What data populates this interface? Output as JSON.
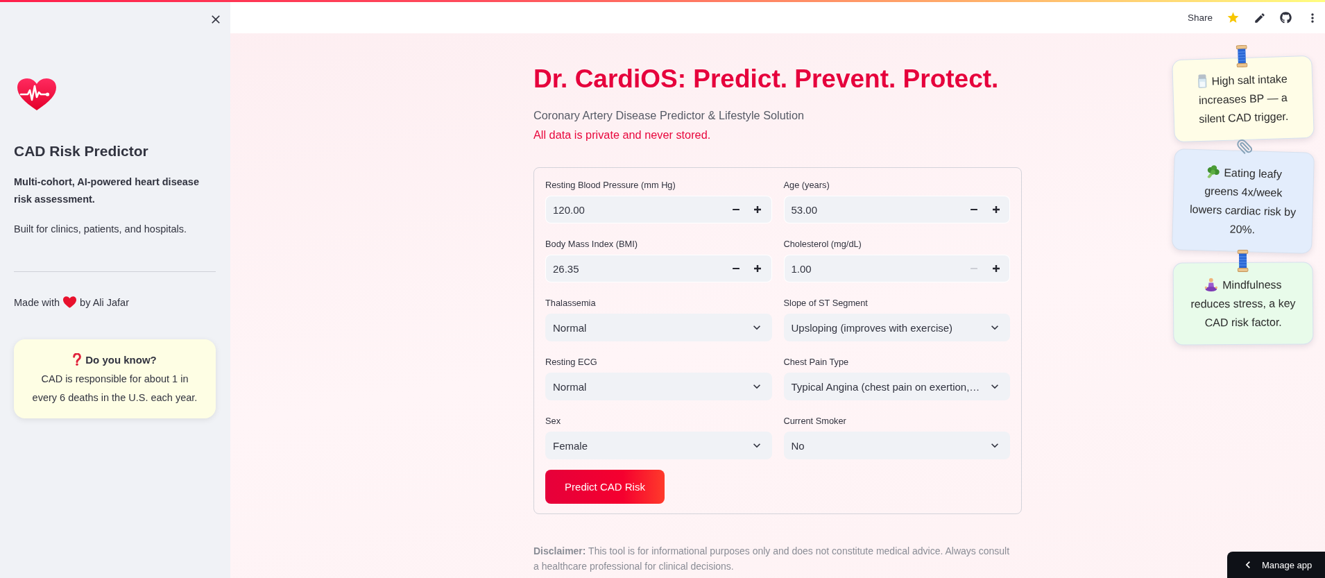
{
  "toolbar": {
    "share": "Share"
  },
  "sidebar": {
    "title": "CAD Risk Predictor",
    "tagline": "Multi-cohort, AI-powered heart disease risk assessment.",
    "description": "Built for clinics, patients, and hospitals.",
    "credit": {
      "before": "Made with",
      "after": "by Ali Jafar"
    },
    "fact_card": {
      "heading": "Do you know?",
      "text": "CAD is responsible for about 1 in every 6 deaths in the U.S. each year."
    }
  },
  "page": {
    "title": "Dr. CardiOS: Predict. Prevent. Protect.",
    "subtitle": "Coronary Artery Disease Predictor & Lifestyle Solution",
    "privacy_note": "All data is private and never stored."
  },
  "form": {
    "fields": [
      {
        "kind": "number",
        "label": "Resting Blood Pressure (mm Hg)",
        "value": "120.00",
        "decrement_disabled": false
      },
      {
        "kind": "number",
        "label": "Age (years)",
        "value": "53.00",
        "decrement_disabled": false
      },
      {
        "kind": "number",
        "label": "Body Mass Index (BMI)",
        "value": "26.35",
        "decrement_disabled": false
      },
      {
        "kind": "number",
        "label": "Cholesterol (mg/dL)",
        "value": "1.00",
        "decrement_disabled": true
      },
      {
        "kind": "select",
        "label": "Thalassemia",
        "value": "Normal"
      },
      {
        "kind": "select",
        "label": "Slope of ST Segment",
        "value": "Upsloping (improves with exercise)"
      },
      {
        "kind": "select",
        "label": "Resting ECG",
        "value": "Normal"
      },
      {
        "kind": "select",
        "label": "Chest Pain Type",
        "value": "Typical Angina (chest pain on exertion,…"
      },
      {
        "kind": "select",
        "label": "Sex",
        "value": "Female"
      },
      {
        "kind": "select",
        "label": "Current Smoker",
        "value": "No"
      }
    ],
    "submit_button": "Predict CAD Risk"
  },
  "disclaimer": "**Disclaimer:** This tool is for informational purposes only and does not constitute medical advice. Always consult a healthcare professional for clinical decisions.",
  "notes": [
    {
      "text": "High salt intake increases BP — a silent CAD trigger.",
      "color": "#fffde7"
    },
    {
      "text": "Eating leafy greens 4x/week lowers cardiac risk by 20%.",
      "color": "#e3edfc"
    },
    {
      "text": "Mindfulness reduces stress, a key CAD risk factor.",
      "color": "#e8fbea"
    }
  ],
  "manage_app": "Manage app"
}
